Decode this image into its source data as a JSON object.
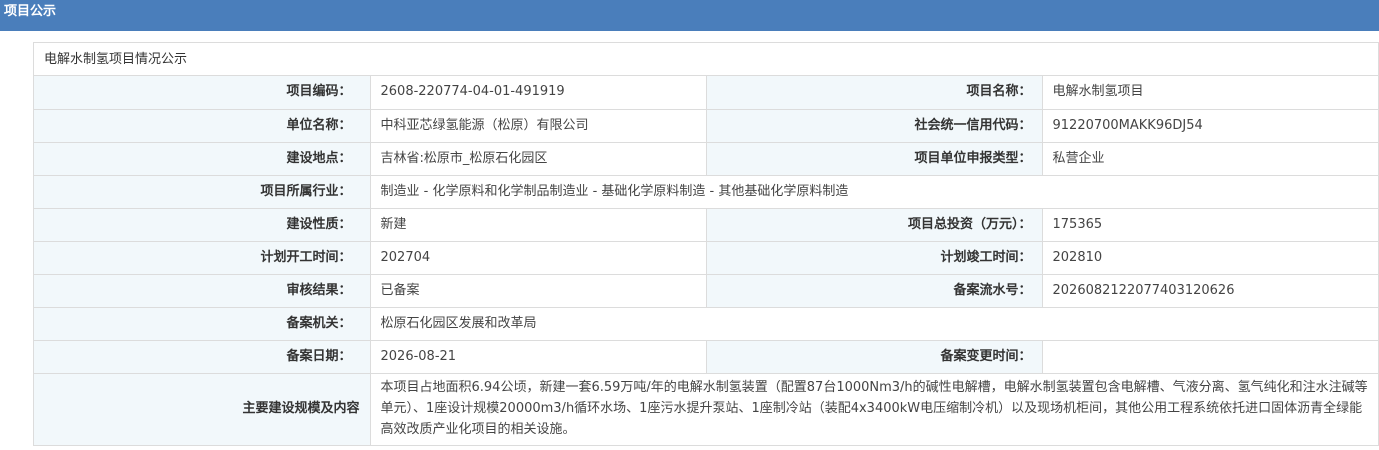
{
  "header": {
    "title": "项目公示"
  },
  "panel": {
    "title": "电解水制氢项目情况公示"
  },
  "rows": [
    {
      "label": "项目编码：",
      "value": "2608-220774-04-01-491919",
      "label2": "项目名称：",
      "value2": "电解水制氢项目"
    },
    {
      "label": "单位名称：",
      "value": "中科亚芯绿氢能源（松原）有限公司",
      "label2": "社会统一信用代码：",
      "value2": "91220700MAKK96DJ54"
    },
    {
      "label": "建设地点：",
      "value": "吉林省:松原市_松原石化园区",
      "label2": "项目单位申报类型：",
      "value2": "私营企业"
    },
    {
      "label": "项目所属行业：",
      "value": "制造业 - 化学原料和化学制品制造业 - 基础化学原料制造 - 其他基础化学原料制造"
    },
    {
      "label": "建设性质：",
      "value": "新建",
      "label2": "项目总投资（万元）：",
      "value2": "175365"
    },
    {
      "label": "计划开工时间：",
      "value": "202704",
      "label2": "计划竣工时间：",
      "value2": "202810"
    },
    {
      "label": "审核结果：",
      "value": "已备案",
      "label2": "备案流水号：",
      "value2": "20260821220774031​20626"
    },
    {
      "label": "备案机关：",
      "value": "松原石化园区发展和改革局"
    },
    {
      "label": "备案日期：",
      "value": "2026-08-21",
      "label2": "备案变更时间：",
      "value2": ""
    },
    {
      "label": "主要建设规模及内容",
      "value": "本项目占地面积6.94公顷，新建一套6.59万吨/年的电解水制氢装置（配置87台1000Nm3/h的碱性电解槽，电解水制氢装置包含电解槽、气液分离、氢气纯化和注水注碱等单元）、1座设计规模20000m3/h循环水场、1座污水提升泵站、1座制冷站（装配4x3400kW电压缩制冷机）以及现场机柜间，其他公用工程系统依托进口固体沥青全绿能高效改质产业化项目的相关设施。"
    }
  ]
}
